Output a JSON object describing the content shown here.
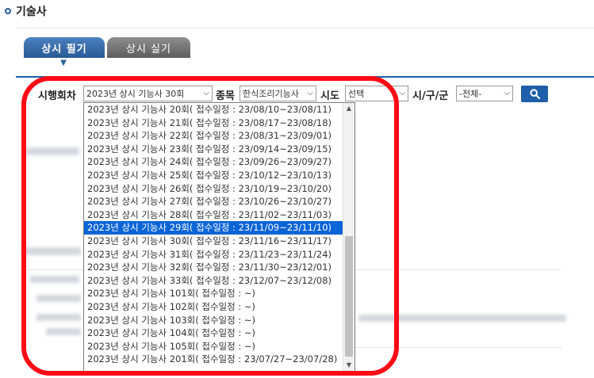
{
  "section": {
    "title": "기술사"
  },
  "tabs": [
    {
      "label": "상시 필기",
      "active": true
    },
    {
      "label": "상시 실기",
      "active": false
    }
  ],
  "search": {
    "round_label": "시행회차",
    "round_value": "2023년 상시 기능사 30회",
    "category_label": "종목",
    "category_value": "한식조리기능사",
    "province_label": "시도",
    "province_value": "선택",
    "city_label": "시/구/군",
    "city_value": "-전체-",
    "search_icon": "magnifier-icon"
  },
  "dropdown": {
    "options": [
      "2023년 상시 기능사 20회( 접수일정 : 23/08/10~23/08/11)",
      "2023년 상시 기능사 21회( 접수일정 : 23/08/17~23/08/18)",
      "2023년 상시 기능사 22회( 접수일정 : 23/08/31~23/09/01)",
      "2023년 상시 기능사 23회( 접수일정 : 23/09/14~23/09/15)",
      "2023년 상시 기능사 24회( 접수일정 : 23/09/26~23/09/27)",
      "2023년 상시 기능사 25회( 접수일정 : 23/10/12~23/10/13)",
      "2023년 상시 기능사 26회( 접수일정 : 23/10/19~23/10/20)",
      "2023년 상시 기능사 27회( 접수일정 : 23/10/26~23/10/27)",
      "2023년 상시 기능사 28회( 접수일정 : 23/11/02~23/11/03)",
      "2023년 상시 기능사 29회( 접수일정 : 23/11/09~23/11/10)",
      "2023년 상시 기능사 30회( 접수일정 : 23/11/16~23/11/17)",
      "2023년 상시 기능사 31회( 접수일정 : 23/11/23~23/11/24)",
      "2023년 상시 기능사 32회( 접수일정 : 23/11/30~23/12/01)",
      "2023년 상시 기능사 33회( 접수일정 : 23/12/07~23/12/08)",
      "2023년 상시 기능사 101회( 접수일정 : ~)",
      "2023년 상시 기능사 102회( 접수일정 : ~)",
      "2023년 상시 기능사 103회( 접수일정 : ~)",
      "2023년 상시 기능사 104회( 접수일정 : ~)",
      "2023년 상시 기능사 105회( 접수일정 : ~)",
      "2023년 상시 기능사 201회( 접수일정 : 23/07/27~23/07/28)"
    ],
    "selected_index": 9
  },
  "colors": {
    "accent": "#1f5ea8",
    "highlight_ring": "#ff0b16",
    "selected_option": "#0a64d6"
  }
}
